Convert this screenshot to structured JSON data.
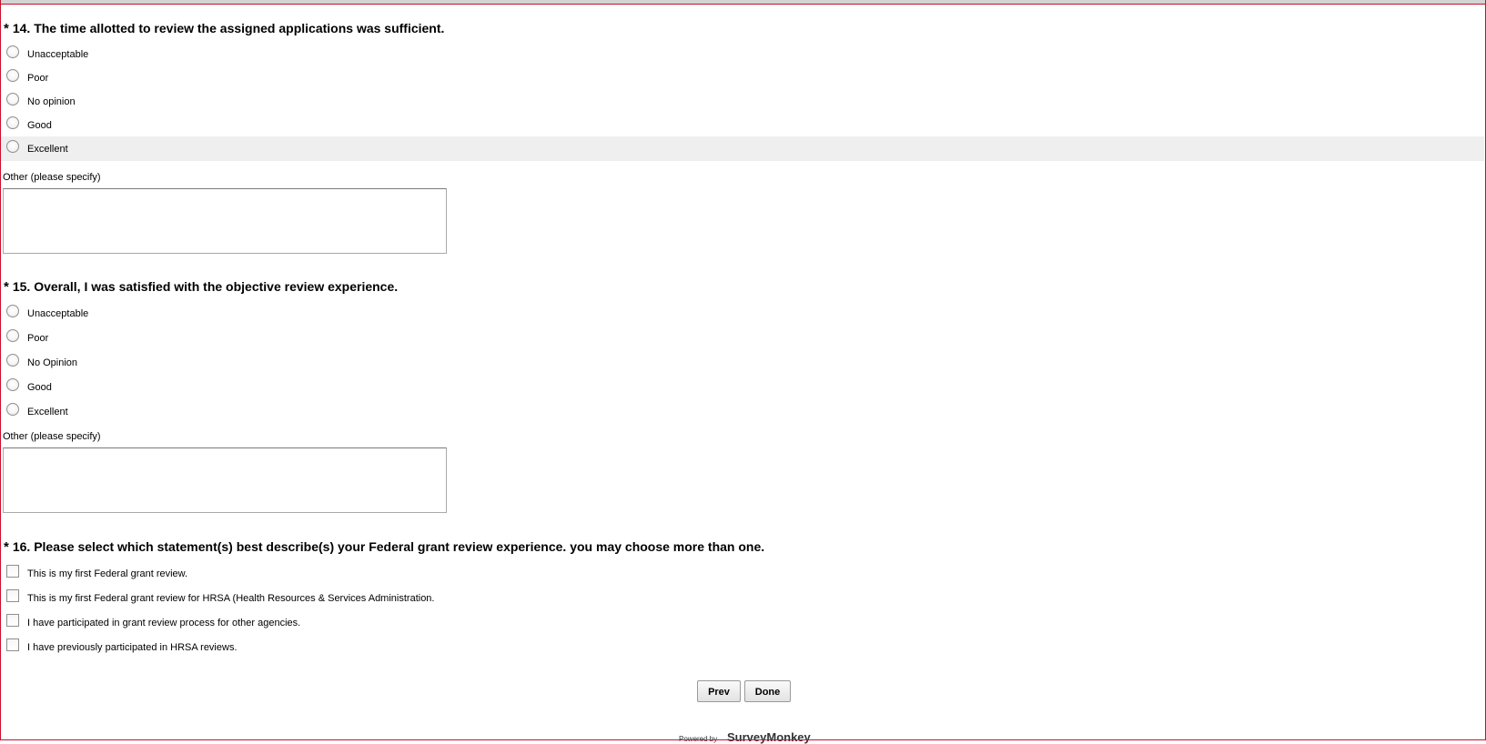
{
  "q14": {
    "star": "*",
    "title": "14. The time allotted to review the assigned applications was sufficient.",
    "options": [
      "Unacceptable",
      "Poor",
      "No opinion",
      "Good",
      "Excellent"
    ],
    "other_label": "Other (please specify)",
    "other_value": ""
  },
  "q15": {
    "star": "*",
    "title": "15. Overall, I was satisfied with the objective review experience.",
    "options": [
      "Unacceptable",
      "Poor",
      "No Opinion",
      "Good",
      "Excellent"
    ],
    "other_label": "Other (please specify)",
    "other_value": ""
  },
  "q16": {
    "star": "*",
    "title": "16. Please select which statement(s) best describe(s) your Federal grant review experience. you may choose more than one.",
    "options": [
      "This is my first Federal grant review.",
      "This is my first Federal grant review for HRSA (Health Resources & Services Administration.",
      "I have participated in grant review process for other agencies.",
      "I have previously participated in HRSA reviews."
    ]
  },
  "nav": {
    "prev_label": "Prev",
    "done_label": "Done"
  },
  "footer": {
    "powered_by": "Powered by",
    "brand": "SurveyMonkey"
  },
  "colors": {
    "frame_border": "#c8102e",
    "hover_row": "#efefef"
  }
}
